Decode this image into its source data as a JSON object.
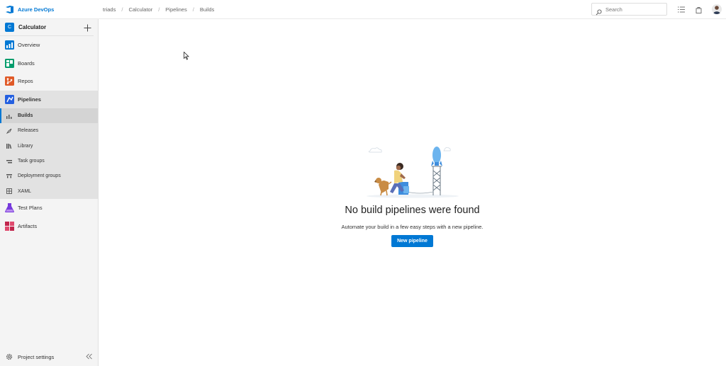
{
  "header": {
    "brand": "Azure DevOps",
    "breadcrumb": [
      "triads",
      "Calculator",
      "Pipelines",
      "Builds"
    ],
    "search_placeholder": "Search"
  },
  "sidebar": {
    "project_initial": "C",
    "project_name": "Calculator",
    "items": [
      {
        "label": "Overview",
        "icon": "overview-icon",
        "color": "#0078d4"
      },
      {
        "label": "Boards",
        "icon": "boards-icon",
        "color": "#009c6b"
      },
      {
        "label": "Repos",
        "icon": "repos-icon",
        "color": "#e05a28"
      },
      {
        "label": "Pipelines",
        "icon": "pipelines-icon",
        "color": "#2560e0"
      },
      {
        "label": "Test Plans",
        "icon": "test-plans-icon",
        "color": "#773adc"
      },
      {
        "label": "Artifacts",
        "icon": "artifacts-icon",
        "color": "#c1264d"
      }
    ],
    "pipelines_sub": [
      {
        "label": "Builds",
        "icon": "builds-icon"
      },
      {
        "label": "Releases",
        "icon": "releases-icon"
      },
      {
        "label": "Library",
        "icon": "library-icon"
      },
      {
        "label": "Task groups",
        "icon": "task-groups-icon"
      },
      {
        "label": "Deployment groups",
        "icon": "deployment-groups-icon"
      },
      {
        "label": "XAML",
        "icon": "xaml-icon"
      }
    ],
    "settings_label": "Project settings"
  },
  "main": {
    "empty_title": "No build pipelines were found",
    "empty_subtitle": "Automate your build in a few easy steps with a new pipeline.",
    "new_pipeline_label": "New pipeline"
  },
  "colors": {
    "accent": "#0078d4"
  }
}
